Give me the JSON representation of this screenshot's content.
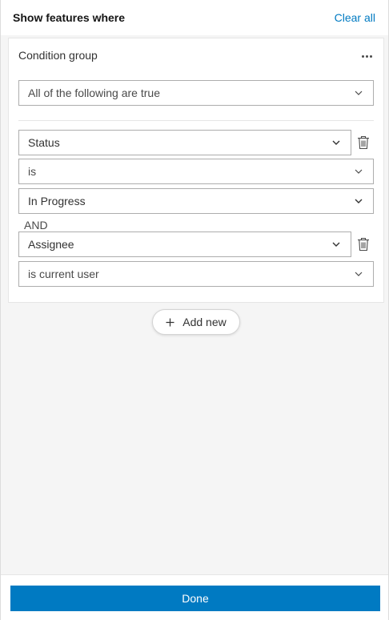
{
  "header": {
    "title": "Show features where",
    "clear_all_label": "Clear all"
  },
  "condition_group": {
    "title": "Condition group",
    "more_icon": "ellipsis-icon",
    "match_select": "All of the following are true",
    "conditions": [
      {
        "field": "Status",
        "operator": "is",
        "value": "In Progress"
      },
      {
        "field": "Assignee",
        "operator": "is current user"
      }
    ],
    "connector": "AND"
  },
  "add_new_label": "Add new",
  "footer": {
    "done_label": "Done"
  },
  "colors": {
    "accent": "#007ac2",
    "panel_bg": "#f5f5f5",
    "card_bg": "#ffffff",
    "border": "#adadad"
  }
}
